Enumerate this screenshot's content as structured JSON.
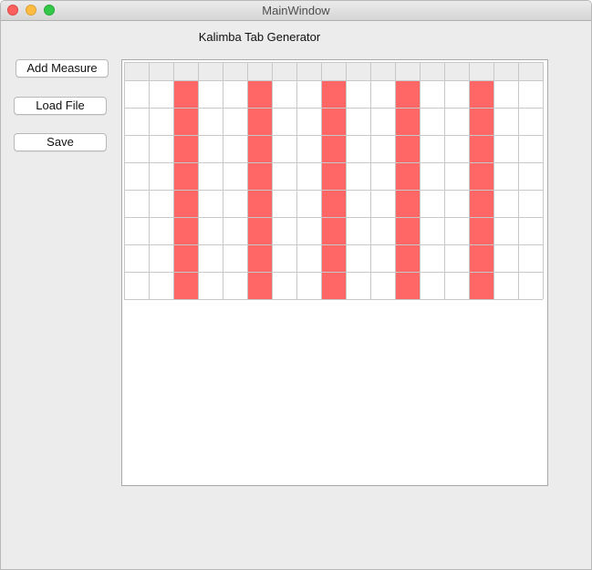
{
  "window": {
    "title": "MainWindow",
    "controls": [
      "close-icon",
      "minimize-icon",
      "zoom-icon"
    ]
  },
  "app": {
    "heading": "Kalimba Tab Generator"
  },
  "sidebar": {
    "add_measure_label": "Add Measure",
    "load_file_label": "Load File",
    "save_label": "Save"
  },
  "grid": {
    "columns": 17,
    "header_rows": 1,
    "rows": 8,
    "highlighted_columns": [
      2,
      5,
      8,
      11,
      14
    ],
    "colors": {
      "highlight": "#ff6666",
      "header": "#ececec",
      "cell": "#ffffff",
      "line": "#c8c8c8"
    }
  }
}
